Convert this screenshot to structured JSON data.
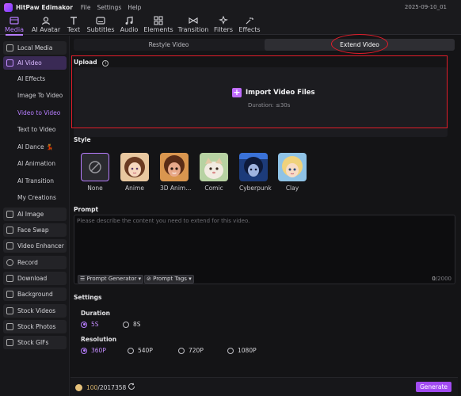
{
  "app": {
    "title": "HitPaw Edimakor",
    "menu": [
      "File",
      "Settings",
      "Help"
    ],
    "date": "2025-09-10_01"
  },
  "toolbar": [
    {
      "label": "Media",
      "icon": "media-icon",
      "active": true
    },
    {
      "label": "AI Avatar",
      "icon": "avatar-icon"
    },
    {
      "label": "Text",
      "icon": "text-icon"
    },
    {
      "label": "Subtitles",
      "icon": "subtitles-icon"
    },
    {
      "label": "Audio",
      "icon": "audio-icon"
    },
    {
      "label": "Elements",
      "icon": "elements-icon"
    },
    {
      "label": "Transition",
      "icon": "transition-icon"
    },
    {
      "label": "Filters",
      "icon": "filters-icon"
    },
    {
      "label": "Effects",
      "icon": "effects-icon"
    }
  ],
  "sidebar": {
    "top": [
      {
        "label": "Local Media"
      },
      {
        "label": "AI Video",
        "active": true
      }
    ],
    "sub": [
      {
        "label": "AI Effects"
      },
      {
        "label": "Image To Video"
      },
      {
        "label": "Video to Video",
        "active": true
      },
      {
        "label": "Text to Video"
      },
      {
        "label": "AI Dance 💃"
      },
      {
        "label": "AI Animation"
      },
      {
        "label": "AI Transition"
      },
      {
        "label": "My Creations"
      }
    ],
    "bottom": [
      {
        "label": "AI Image"
      },
      {
        "label": "Face Swap"
      },
      {
        "label": "Video Enhancer"
      },
      {
        "label": "Record"
      },
      {
        "label": "Download"
      },
      {
        "label": "Background"
      },
      {
        "label": "Stock Videos"
      },
      {
        "label": "Stock Photos"
      },
      {
        "label": "Stock GIFs"
      }
    ]
  },
  "tabs": [
    {
      "label": "Restyle Video"
    },
    {
      "label": "Extend Video",
      "active": true
    }
  ],
  "upload": {
    "title": "Upload",
    "info_icon": "info-icon",
    "button_label": "Import Video Files",
    "duration": "Duration: ≤30s"
  },
  "style": {
    "title": "Style",
    "items": [
      {
        "label": "None",
        "selected": true
      },
      {
        "label": "Anime"
      },
      {
        "label": "3D Anim..."
      },
      {
        "label": "Comic"
      },
      {
        "label": "Cyberpunk"
      },
      {
        "label": "Clay"
      }
    ]
  },
  "prompt": {
    "title": "Prompt",
    "placeholder": "Please describe the content you need to extend for this video.",
    "generator_label": "Prompt Generator",
    "tags_label": "Prompt Tags",
    "count": "0",
    "max": "/2000"
  },
  "settings": {
    "title": "Settings",
    "duration_label": "Duration",
    "durations": [
      {
        "label": "5S",
        "selected": true
      },
      {
        "label": "8S"
      }
    ],
    "resolution_label": "Resolution",
    "resolutions": [
      {
        "label": "360P",
        "selected": true
      },
      {
        "label": "540P"
      },
      {
        "label": "720P"
      },
      {
        "label": "1080P"
      }
    ]
  },
  "footer": {
    "credits_used": "100",
    "credits_total": "/2017358",
    "generate_label": "Generate"
  },
  "colors": {
    "accent": "#b77dff",
    "generate": "#a24bf2",
    "highlight": "#e11d2a"
  }
}
